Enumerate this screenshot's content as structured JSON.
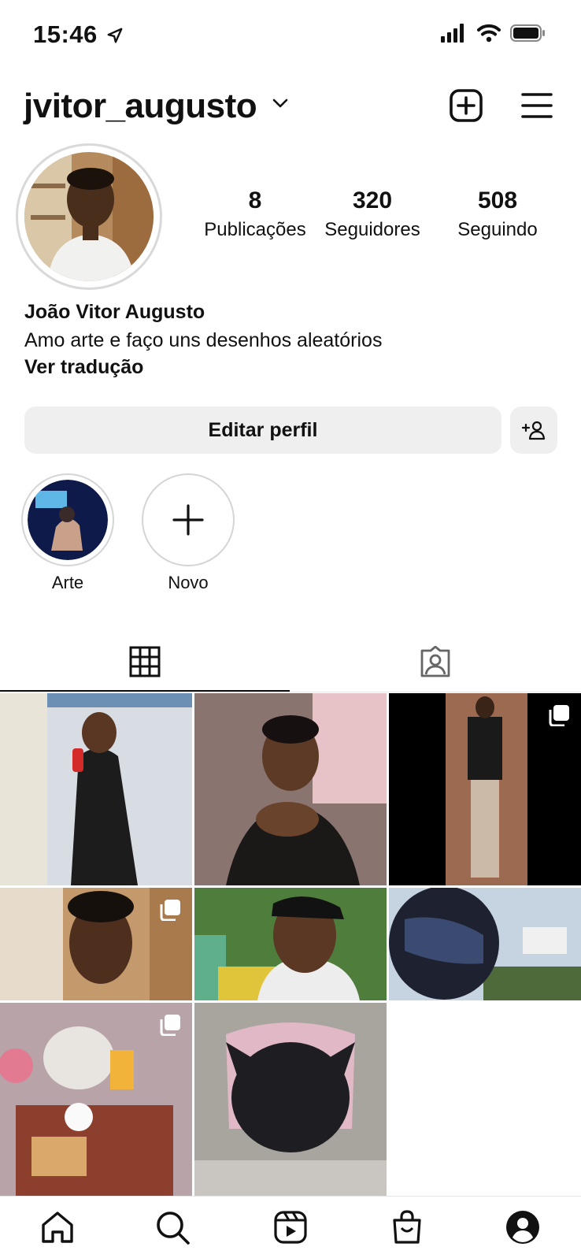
{
  "status_bar": {
    "time": "15:46"
  },
  "header": {
    "username": "jvitor_augusto"
  },
  "stats": [
    {
      "count": "8",
      "label": "Publicações"
    },
    {
      "count": "320",
      "label": "Seguidores"
    },
    {
      "count": "508",
      "label": "Seguindo"
    }
  ],
  "bio": {
    "name": "João Vitor Augusto",
    "text": "Amo arte e faço uns desenhos aleatórios",
    "translate": "Ver tradução"
  },
  "actions": {
    "edit_profile": "Editar perfil"
  },
  "highlights": [
    {
      "label": "Arte"
    },
    {
      "label": "Novo"
    }
  ],
  "icons": {
    "create": "plus-square-icon",
    "menu": "hamburger-menu-icon",
    "add_person": "add-person-icon",
    "grid_tab": "grid-icon",
    "tagged_tab": "tagged-person-icon",
    "nav": [
      "home-icon",
      "search-icon",
      "reels-icon",
      "shop-icon",
      "profile-icon"
    ]
  },
  "colors": {
    "text": "#111111",
    "button_bg": "#efefef",
    "divider": "#e6e6e6"
  }
}
